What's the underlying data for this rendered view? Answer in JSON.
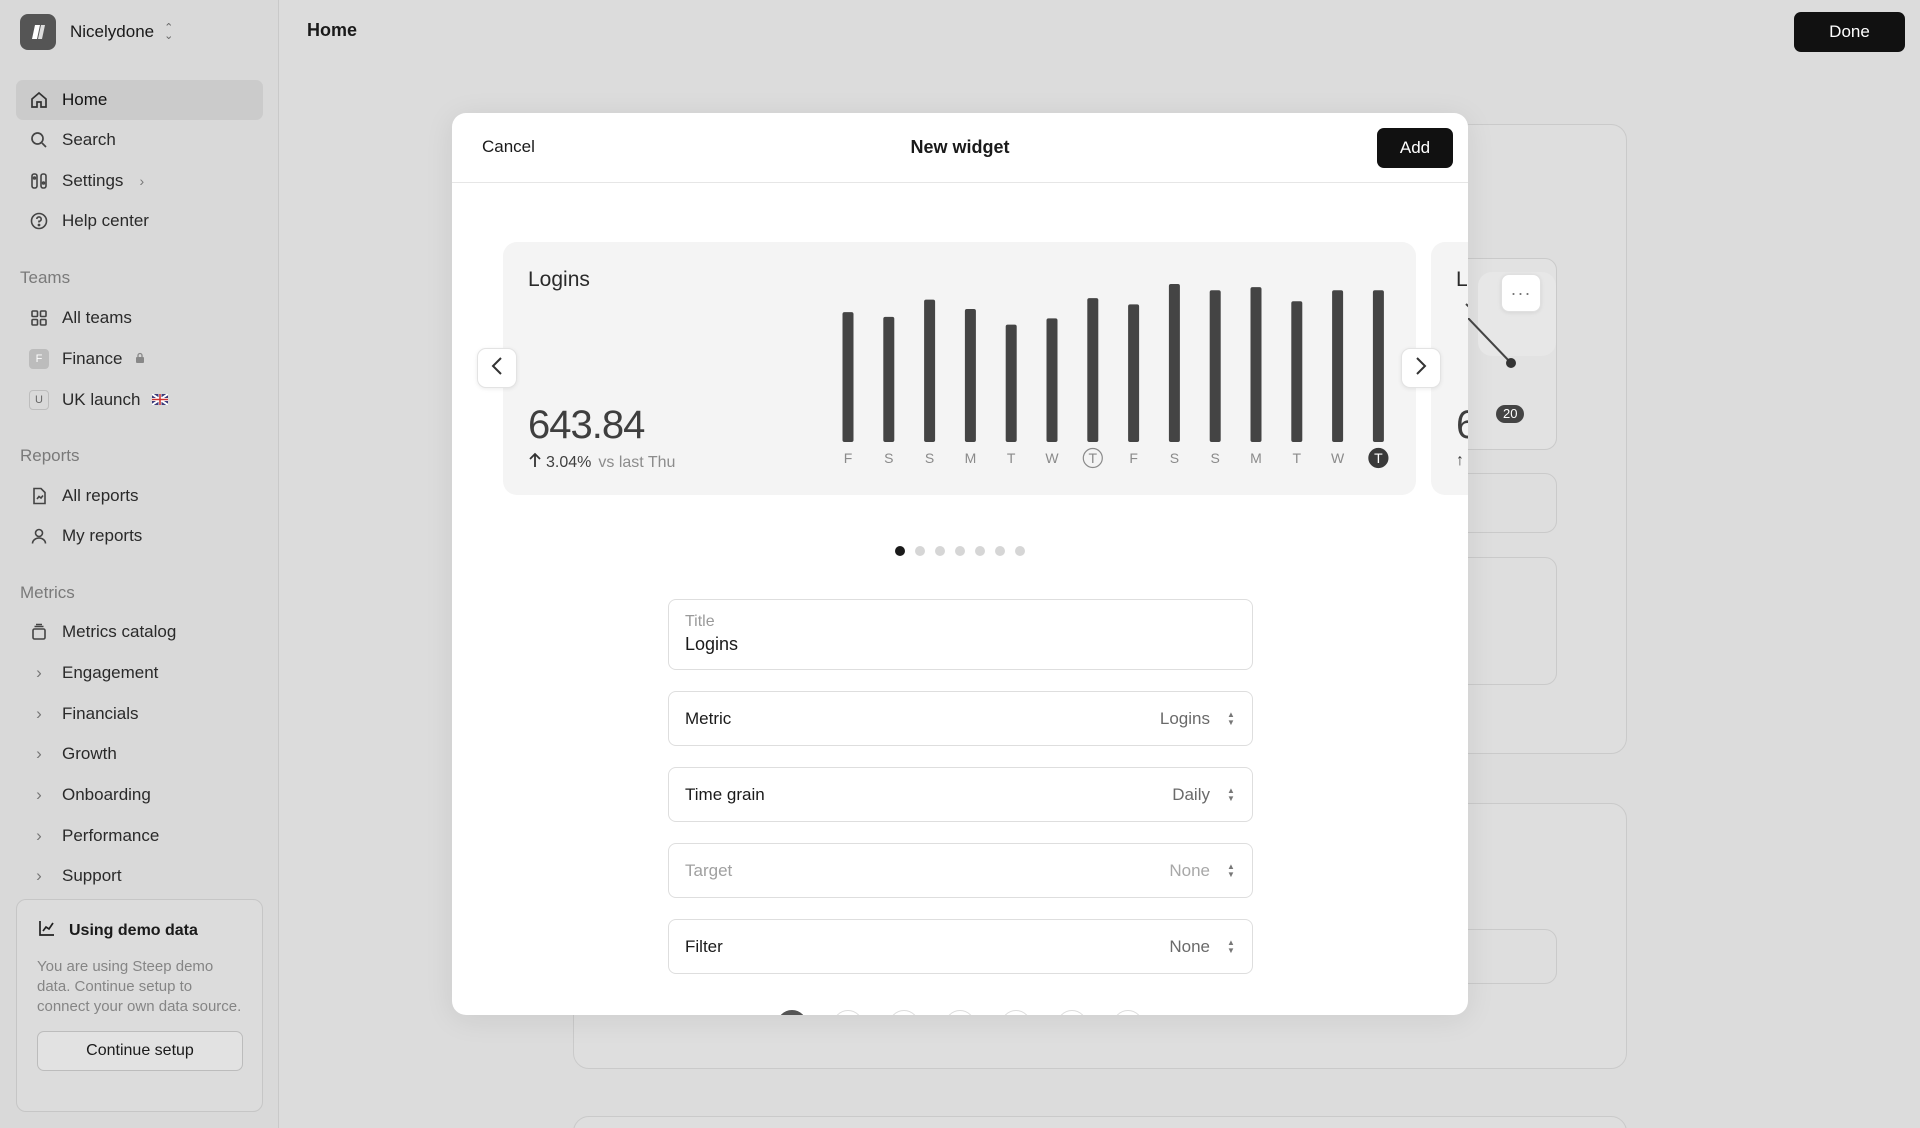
{
  "org": {
    "name": "Nicelydone"
  },
  "sidebar": {
    "nav": [
      {
        "label": "Home",
        "icon": "home-icon"
      },
      {
        "label": "Search",
        "icon": "search-icon"
      },
      {
        "label": "Settings",
        "icon": "settings-icon"
      },
      {
        "label": "Help center",
        "icon": "help-icon"
      }
    ],
    "teams_heading": "Teams",
    "teams": [
      {
        "label": "All teams",
        "badge": ""
      },
      {
        "label": "Finance",
        "badge": "F"
      },
      {
        "label": "UK launch",
        "badge": "U"
      }
    ],
    "reports_heading": "Reports",
    "reports": [
      {
        "label": "All reports"
      },
      {
        "label": "My reports"
      }
    ],
    "metrics_heading": "Metrics",
    "metrics": [
      {
        "label": "Metrics catalog"
      },
      {
        "label": "Engagement"
      },
      {
        "label": "Financials"
      },
      {
        "label": "Growth"
      },
      {
        "label": "Onboarding"
      },
      {
        "label": "Performance"
      },
      {
        "label": "Support"
      }
    ],
    "demo": {
      "title": "Using demo data",
      "text": "You are using Steep demo data. Continue setup to connect your own data source.",
      "button": "Continue setup"
    }
  },
  "header": {
    "title": "Home",
    "done_label": "Done"
  },
  "modal": {
    "cancel_label": "Cancel",
    "title": "New widget",
    "add_label": "Add",
    "preview": {
      "title": "Logins",
      "value": "643.84",
      "delta": "3.04%",
      "delta_context": "vs last Thu"
    },
    "peek": {
      "title": "L",
      "value": "6",
      "badge": "20"
    },
    "page_count": 7,
    "active_page": 0,
    "form": {
      "title_label": "Title",
      "title_value": "Logins",
      "metric_label": "Metric",
      "metric_value": "Logins",
      "grain_label": "Time grain",
      "grain_value": "Daily",
      "target_label": "Target",
      "target_value": "None",
      "filter_label": "Filter",
      "filter_value": "None"
    }
  },
  "chart_data": {
    "type": "bar",
    "categories": [
      "F",
      "S",
      "S",
      "M",
      "T",
      "W",
      "T",
      "F",
      "S",
      "S",
      "M",
      "T",
      "W",
      "T"
    ],
    "values": [
      83,
      80,
      91,
      85,
      75,
      79,
      92,
      88,
      101,
      97,
      99,
      90,
      97,
      97
    ],
    "ylim": [
      0,
      101
    ],
    "highlight": [
      6,
      13
    ],
    "bar_color": "#444444"
  },
  "colors": {
    "accent": "#111111",
    "sidebar_bg": "#d9d9d9",
    "backdrop": "#dcdcdc"
  }
}
